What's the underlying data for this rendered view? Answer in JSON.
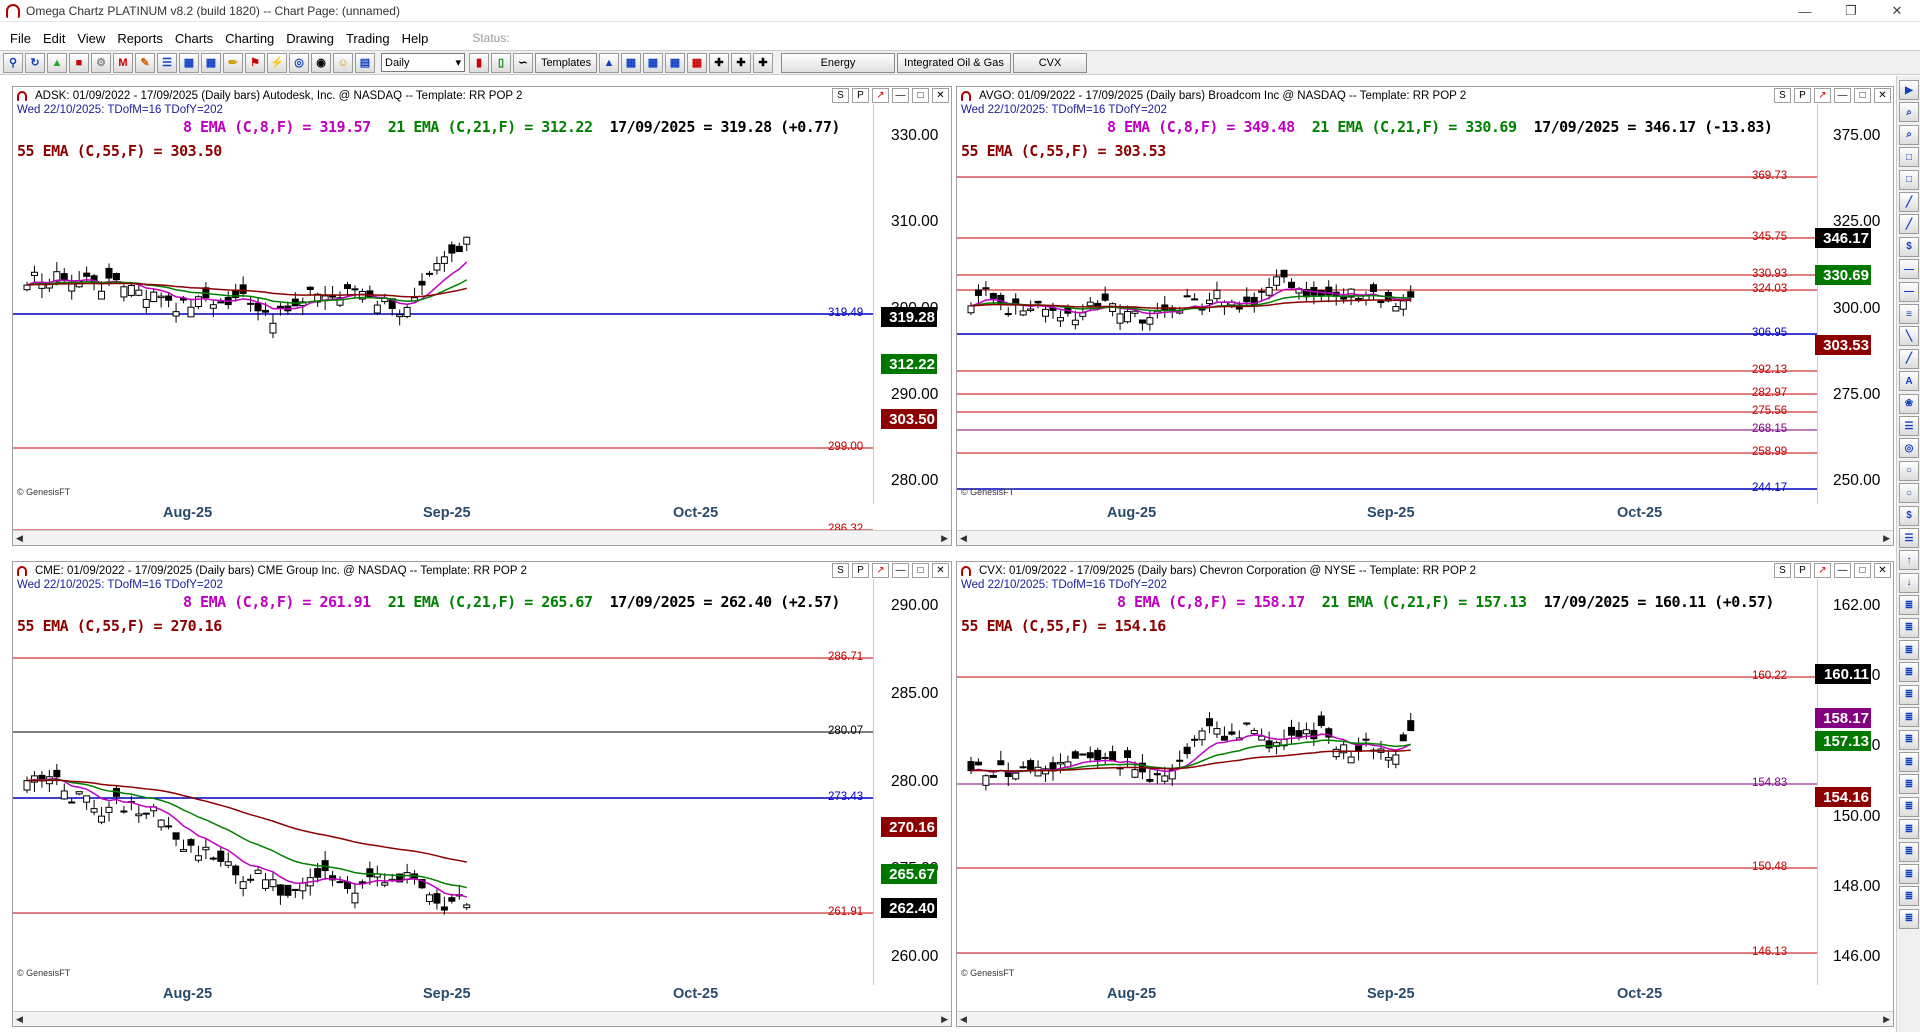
{
  "app": {
    "title": "Omega Chartz PLATINUM v8.2 (build 1820)  --  Chart Page: (unnamed)"
  },
  "menu": [
    "File",
    "Edit",
    "View",
    "Reports",
    "Charts",
    "Charting",
    "Drawing",
    "Trading",
    "Help"
  ],
  "status_label": "Status:",
  "toolbar": {
    "period": "Daily",
    "templates": "Templates",
    "tabs": [
      "Energy",
      "Integrated Oil & Gas",
      "CVX"
    ]
  },
  "copyright": "© GenesisFT",
  "panels": [
    {
      "header": "ADSK: 01/09/2022 - 17/09/2025  (Daily bars)  Autodesk, Inc. @ NASDAQ  --  Template: RR POP 2",
      "subheader": "Wed  22/10/2025:   TDofM=16   TDofY=202",
      "ema8": "8 EMA (C,8,F) = 319.57",
      "ema21": "21 EMA (C,21,F) = 312.22",
      "last": "17/09/2025 = 319.28 (+0.77)",
      "ema55": "55 EMA (C,55,F) = 303.50",
      "yaxis": [
        "330.00",
        "310.00",
        "300.00",
        "290.00",
        "280.00"
      ],
      "levels": [
        {
          "v": "319.49",
          "c": "#0000c0"
        },
        {
          "v": "299.00",
          "c": "#c00000"
        },
        {
          "v": "286.32",
          "c": "#c00000"
        }
      ],
      "boxes": [
        "319.28",
        "312.22",
        "303.50"
      ],
      "months": [
        "Aug-25",
        "Sep-25",
        "Oct-25"
      ]
    },
    {
      "header": "AVGO: 01/09/2022 - 17/09/2025  (Daily bars)  Broadcom Inc @ NASDAQ  --  Template: RR POP 2",
      "subheader": "Wed  22/10/2025:   TDofM=16   TDofY=202",
      "ema8": "8 EMA (C,8,F) = 349.48",
      "ema21": "21 EMA (C,21,F) = 330.69",
      "last": "17/09/2025 = 346.17 (-13.83)",
      "ema55": "55 EMA (C,55,F) = 303.53",
      "yaxis": [
        "375.00",
        "325.00",
        "300.00",
        "275.00",
        "250.00"
      ],
      "levels": [
        {
          "v": "369.73",
          "c": "#c00000"
        },
        {
          "v": "345.75",
          "c": "#c00000"
        },
        {
          "v": "330.93",
          "c": "#c00000"
        },
        {
          "v": "324.03",
          "c": "#c00000"
        },
        {
          "v": "306.95",
          "c": "#0000c0"
        },
        {
          "v": "292.13",
          "c": "#c00000"
        },
        {
          "v": "282.97",
          "c": "#c00000"
        },
        {
          "v": "275.56",
          "c": "#c00000"
        },
        {
          "v": "268.15",
          "c": "#800080"
        },
        {
          "v": "258.99",
          "c": "#c00000"
        },
        {
          "v": "244.17",
          "c": "#0000c0"
        }
      ],
      "boxes": [
        "346.17",
        "330.69",
        "303.53"
      ],
      "months": [
        "Aug-25",
        "Sep-25",
        "Oct-25"
      ]
    },
    {
      "header": "CME: 01/09/2022 - 17/09/2025  (Daily bars)  CME Group Inc. @ NASDAQ  --  Template: RR POP 2",
      "subheader": "Wed  22/10/2025:   TDofM=16   TDofY=202",
      "ema8": "8 EMA (C,8,F) = 261.91",
      "ema21": "21 EMA (C,21,F) = 265.67",
      "last": "17/09/2025 = 262.40 (+2.57)",
      "ema55": "55 EMA (C,55,F) = 270.16",
      "yaxis": [
        "290.00",
        "285.00",
        "280.00",
        "275.00",
        "260.00"
      ],
      "levels": [
        {
          "v": "286.71",
          "c": "#c00000"
        },
        {
          "v": "280.07",
          "c": "#000000"
        },
        {
          "v": "273.43",
          "c": "#0000c0"
        },
        {
          "v": "261.91",
          "c": "#c00000"
        }
      ],
      "boxes": [
        "270.16",
        "265.67",
        "262.40"
      ],
      "months": [
        "Aug-25",
        "Sep-25",
        "Oct-25"
      ]
    },
    {
      "header": "CVX: 01/09/2022 - 17/09/2025  (Daily bars)  Chevron Corporation @ NYSE  --  Template: RR POP 2",
      "subheader": "Wed  22/10/2025:   TDofM=16   TDofY=202",
      "ema8": "8 EMA (C,8,F) = 158.17",
      "ema21": "21 EMA (C,21,F) = 157.13",
      "last": "17/09/2025 = 160.11 (+0.57)",
      "ema55": "55 EMA (C,55,F) = 154.16",
      "yaxis": [
        "162.00",
        "156.00",
        "152.00",
        "150.00",
        "148.00",
        "146.00"
      ],
      "levels": [
        {
          "v": "160.22",
          "c": "#c00000"
        },
        {
          "v": "154.83",
          "c": "#800080"
        },
        {
          "v": "150.48",
          "c": "#c00000"
        },
        {
          "v": "146.13",
          "c": "#c00000"
        }
      ],
      "boxes": [
        "160.11",
        "158.17",
        "157.13",
        "154.16"
      ],
      "months": [
        "Aug-25",
        "Sep-25",
        "Oct-25"
      ]
    }
  ]
}
